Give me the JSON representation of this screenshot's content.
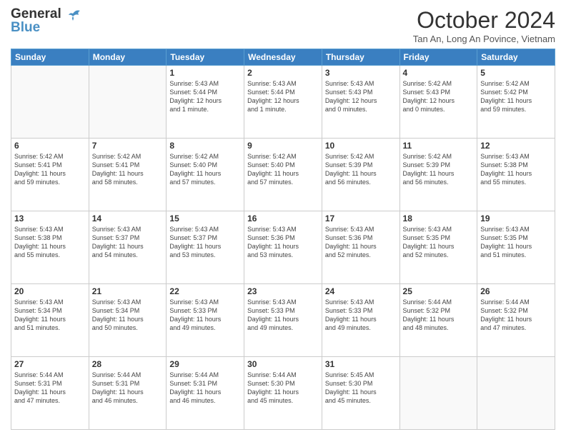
{
  "header": {
    "logo_line1": "General",
    "logo_line2": "Blue",
    "month_title": "October 2024",
    "subtitle": "Tan An, Long An Povince, Vietnam"
  },
  "days_of_week": [
    "Sunday",
    "Monday",
    "Tuesday",
    "Wednesday",
    "Thursday",
    "Friday",
    "Saturday"
  ],
  "weeks": [
    [
      {
        "day": "",
        "info": ""
      },
      {
        "day": "",
        "info": ""
      },
      {
        "day": "1",
        "info": "Sunrise: 5:43 AM\nSunset: 5:44 PM\nDaylight: 12 hours\nand 1 minute."
      },
      {
        "day": "2",
        "info": "Sunrise: 5:43 AM\nSunset: 5:44 PM\nDaylight: 12 hours\nand 1 minute."
      },
      {
        "day": "3",
        "info": "Sunrise: 5:43 AM\nSunset: 5:43 PM\nDaylight: 12 hours\nand 0 minutes."
      },
      {
        "day": "4",
        "info": "Sunrise: 5:42 AM\nSunset: 5:43 PM\nDaylight: 12 hours\nand 0 minutes."
      },
      {
        "day": "5",
        "info": "Sunrise: 5:42 AM\nSunset: 5:42 PM\nDaylight: 11 hours\nand 59 minutes."
      }
    ],
    [
      {
        "day": "6",
        "info": "Sunrise: 5:42 AM\nSunset: 5:41 PM\nDaylight: 11 hours\nand 59 minutes."
      },
      {
        "day": "7",
        "info": "Sunrise: 5:42 AM\nSunset: 5:41 PM\nDaylight: 11 hours\nand 58 minutes."
      },
      {
        "day": "8",
        "info": "Sunrise: 5:42 AM\nSunset: 5:40 PM\nDaylight: 11 hours\nand 57 minutes."
      },
      {
        "day": "9",
        "info": "Sunrise: 5:42 AM\nSunset: 5:40 PM\nDaylight: 11 hours\nand 57 minutes."
      },
      {
        "day": "10",
        "info": "Sunrise: 5:42 AM\nSunset: 5:39 PM\nDaylight: 11 hours\nand 56 minutes."
      },
      {
        "day": "11",
        "info": "Sunrise: 5:42 AM\nSunset: 5:39 PM\nDaylight: 11 hours\nand 56 minutes."
      },
      {
        "day": "12",
        "info": "Sunrise: 5:43 AM\nSunset: 5:38 PM\nDaylight: 11 hours\nand 55 minutes."
      }
    ],
    [
      {
        "day": "13",
        "info": "Sunrise: 5:43 AM\nSunset: 5:38 PM\nDaylight: 11 hours\nand 55 minutes."
      },
      {
        "day": "14",
        "info": "Sunrise: 5:43 AM\nSunset: 5:37 PM\nDaylight: 11 hours\nand 54 minutes."
      },
      {
        "day": "15",
        "info": "Sunrise: 5:43 AM\nSunset: 5:37 PM\nDaylight: 11 hours\nand 53 minutes."
      },
      {
        "day": "16",
        "info": "Sunrise: 5:43 AM\nSunset: 5:36 PM\nDaylight: 11 hours\nand 53 minutes."
      },
      {
        "day": "17",
        "info": "Sunrise: 5:43 AM\nSunset: 5:36 PM\nDaylight: 11 hours\nand 52 minutes."
      },
      {
        "day": "18",
        "info": "Sunrise: 5:43 AM\nSunset: 5:35 PM\nDaylight: 11 hours\nand 52 minutes."
      },
      {
        "day": "19",
        "info": "Sunrise: 5:43 AM\nSunset: 5:35 PM\nDaylight: 11 hours\nand 51 minutes."
      }
    ],
    [
      {
        "day": "20",
        "info": "Sunrise: 5:43 AM\nSunset: 5:34 PM\nDaylight: 11 hours\nand 51 minutes."
      },
      {
        "day": "21",
        "info": "Sunrise: 5:43 AM\nSunset: 5:34 PM\nDaylight: 11 hours\nand 50 minutes."
      },
      {
        "day": "22",
        "info": "Sunrise: 5:43 AM\nSunset: 5:33 PM\nDaylight: 11 hours\nand 49 minutes."
      },
      {
        "day": "23",
        "info": "Sunrise: 5:43 AM\nSunset: 5:33 PM\nDaylight: 11 hours\nand 49 minutes."
      },
      {
        "day": "24",
        "info": "Sunrise: 5:43 AM\nSunset: 5:33 PM\nDaylight: 11 hours\nand 49 minutes."
      },
      {
        "day": "25",
        "info": "Sunrise: 5:44 AM\nSunset: 5:32 PM\nDaylight: 11 hours\nand 48 minutes."
      },
      {
        "day": "26",
        "info": "Sunrise: 5:44 AM\nSunset: 5:32 PM\nDaylight: 11 hours\nand 47 minutes."
      }
    ],
    [
      {
        "day": "27",
        "info": "Sunrise: 5:44 AM\nSunset: 5:31 PM\nDaylight: 11 hours\nand 47 minutes."
      },
      {
        "day": "28",
        "info": "Sunrise: 5:44 AM\nSunset: 5:31 PM\nDaylight: 11 hours\nand 46 minutes."
      },
      {
        "day": "29",
        "info": "Sunrise: 5:44 AM\nSunset: 5:31 PM\nDaylight: 11 hours\nand 46 minutes."
      },
      {
        "day": "30",
        "info": "Sunrise: 5:44 AM\nSunset: 5:30 PM\nDaylight: 11 hours\nand 45 minutes."
      },
      {
        "day": "31",
        "info": "Sunrise: 5:45 AM\nSunset: 5:30 PM\nDaylight: 11 hours\nand 45 minutes."
      },
      {
        "day": "",
        "info": ""
      },
      {
        "day": "",
        "info": ""
      }
    ]
  ]
}
